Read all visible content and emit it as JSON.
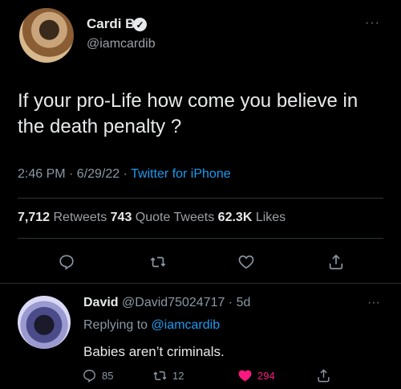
{
  "tweet": {
    "display_name": "Cardi B",
    "handle": "@iamcardib",
    "more": "···",
    "text": "If your pro-Life how come you believe in the death penalty ?",
    "time": "2:46 PM · 6/29/22 · ",
    "source": "Twitter for iPhone",
    "retweets": "7,712",
    "retweets_label": " Retweets ",
    "quotes": "743",
    "quotes_label": " Quote Tweets ",
    "likes": "62.3K",
    "likes_label": " Likes"
  },
  "icons": {
    "reply": "reply-icon",
    "retweet": "retweet-icon",
    "like": "heart-icon",
    "share": "share-icon",
    "verified": "verified-badge-icon"
  },
  "reply": {
    "display_name": "David",
    "handle_time": " @David75024717 · 5d",
    "replying_prefix": "Replying to ",
    "replying_to": "@iamcardib",
    "text": "Babies aren’t criminals.",
    "more": "···",
    "reply_count": "85",
    "retweet_count": "12",
    "like_count": "294"
  },
  "colors": {
    "accent": "#1d9bf0",
    "like": "#f91880",
    "muted": "#8b98a5"
  }
}
